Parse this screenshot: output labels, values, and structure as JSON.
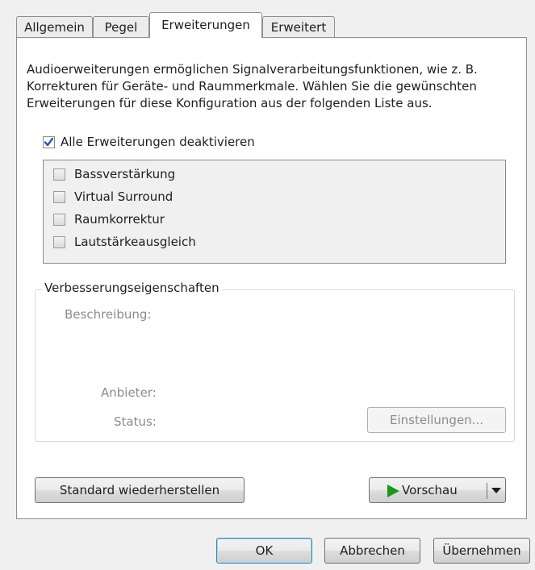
{
  "tabs": [
    {
      "label": "Allgemein"
    },
    {
      "label": "Pegel"
    },
    {
      "label": "Erweiterungen"
    },
    {
      "label": "Erweitert"
    }
  ],
  "description": [
    "Audioerweiterungen ermöglichen Signalverarbeitungsfunktionen, wie z. B.",
    "Korrekturen für Geräte- und Raummerkmale. Wählen Sie die gewünschten",
    "Erweiterungen für diese Konfiguration aus der folgenden Liste aus."
  ],
  "disable_all": {
    "label": "Alle Erweiterungen deaktivieren",
    "checked": true
  },
  "enhancements": [
    {
      "label": "Bassverstärkung",
      "checked": false
    },
    {
      "label": "Virtual Surround",
      "checked": false
    },
    {
      "label": "Raumkorrektur",
      "checked": false
    },
    {
      "label": "Lautstärkeausgleich",
      "checked": false
    }
  ],
  "properties": {
    "title": "Verbesserungseigenschaften",
    "description_label": "Beschreibung:",
    "provider_label": "Anbieter:",
    "status_label": "Status:",
    "settings_button": "Einstellungen..."
  },
  "restore_button": "Standard wiederherstellen",
  "preview_button": "Vorschau",
  "footer": {
    "ok": "OK",
    "cancel": "Abbrechen",
    "apply": "Übernehmen"
  },
  "colors": {
    "check_mark": "#1f57b8",
    "play_icon": "#1c9a16"
  }
}
